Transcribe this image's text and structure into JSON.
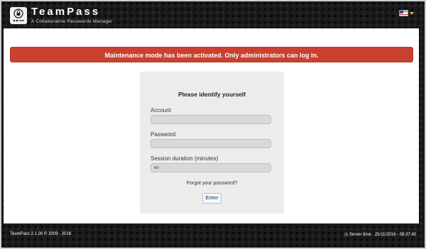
{
  "header": {
    "brand": "TeamPass",
    "tagline": "A Collaborative Passwords Manager",
    "language_icon": "us-flag-icon"
  },
  "alert": {
    "message": "Maintenance mode has been activated. Only administrators can log in.",
    "color": "#c9412f"
  },
  "login": {
    "title": "Please identify yourself",
    "account_label": "Account",
    "account_value": "",
    "password_label": "Password",
    "password_value": "",
    "session_label": "Session duration (minutes)",
    "session_value": "60",
    "forgot_link": "Forgot your password?",
    "enter_button": "Enter"
  },
  "footer": {
    "left": "TeamPass 2.1.26 © 2009 - 2016",
    "right": "Server time : 25/11/2016 - 08:37:40",
    "clock_icon": "clock-icon"
  }
}
